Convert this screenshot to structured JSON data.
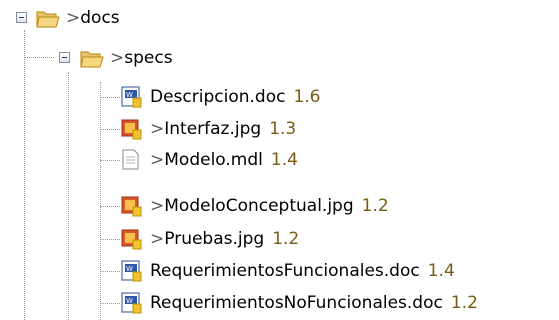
{
  "tree": {
    "root": {
      "prefix": ">",
      "name": "docs",
      "icon": "open-folder-icon",
      "expanded": true
    },
    "child": {
      "prefix": ">",
      "name": "specs",
      "icon": "open-folder-icon",
      "expanded": true
    },
    "files": [
      {
        "prefix": "",
        "name": "Descripcion.doc",
        "version": "1.6",
        "icon": "word-doc-icon"
      },
      {
        "prefix": ">",
        "name": "Interfaz.jpg",
        "version": "1.3",
        "icon": "image-file-icon"
      },
      {
        "prefix": ">",
        "name": "Modelo.mdl",
        "version": "1.4",
        "icon": "text-file-icon"
      },
      {
        "prefix": ">",
        "name": "ModeloConceptual.jpg",
        "version": "1.2",
        "icon": "image-file-icon"
      },
      {
        "prefix": ">",
        "name": "Pruebas.jpg",
        "version": "1.2",
        "icon": "image-file-icon"
      },
      {
        "prefix": "",
        "name": "RequerimientosFuncionales.doc",
        "version": "1.4",
        "icon": "word-doc-icon"
      },
      {
        "prefix": "",
        "name": "RequerimientosNoFuncionales.doc",
        "version": "1.2",
        "icon": "word-doc-icon"
      }
    ]
  }
}
